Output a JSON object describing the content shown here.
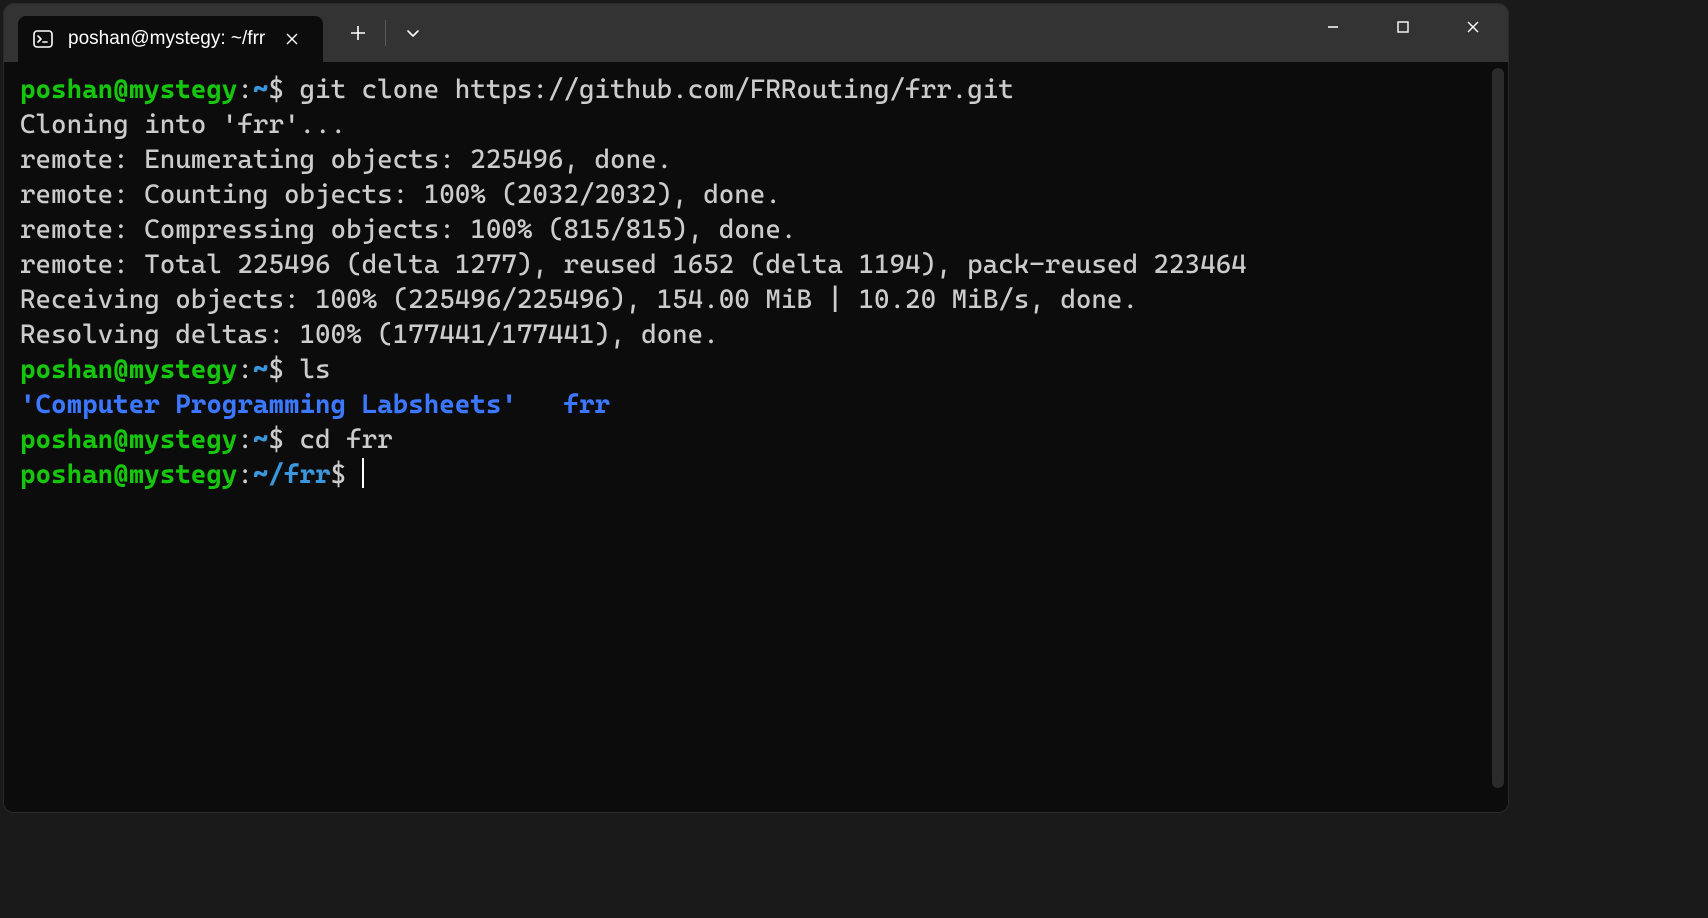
{
  "tab": {
    "title": "poshan@mystegy: ~/frr"
  },
  "lines": [
    {
      "user": "poshan@mystegy",
      "colon": ":",
      "path": "~",
      "prompt": "$ ",
      "cmd": "git clone https://github.com/FRRouting/frr.git"
    },
    {
      "out": "Cloning into 'frr'..."
    },
    {
      "out": "remote: Enumerating objects: 225496, done."
    },
    {
      "out": "remote: Counting objects: 100% (2032/2032), done."
    },
    {
      "out": "remote: Compressing objects: 100% (815/815), done."
    },
    {
      "out": "remote: Total 225496 (delta 1277), reused 1652 (delta 1194), pack-reused 223464"
    },
    {
      "out": "Receiving objects: 100% (225496/225496), 154.00 MiB | 10.20 MiB/s, done."
    },
    {
      "out": "Resolving deltas: 100% (177441/177441), done."
    },
    {
      "user": "poshan@mystegy",
      "colon": ":",
      "path": "~",
      "prompt": "$ ",
      "cmd": "ls"
    },
    {
      "ls_dir1": "'Computer Programming Labsheets'",
      "ls_sep": "   ",
      "ls_dir2": "frr"
    },
    {
      "user": "poshan@mystegy",
      "colon": ":",
      "path": "~",
      "prompt": "$ ",
      "cmd": "cd frr"
    },
    {
      "user": "poshan@mystegy",
      "colon": ":",
      "path": "~/frr",
      "prompt": "$ ",
      "cmd": "",
      "cursor": true
    }
  ]
}
